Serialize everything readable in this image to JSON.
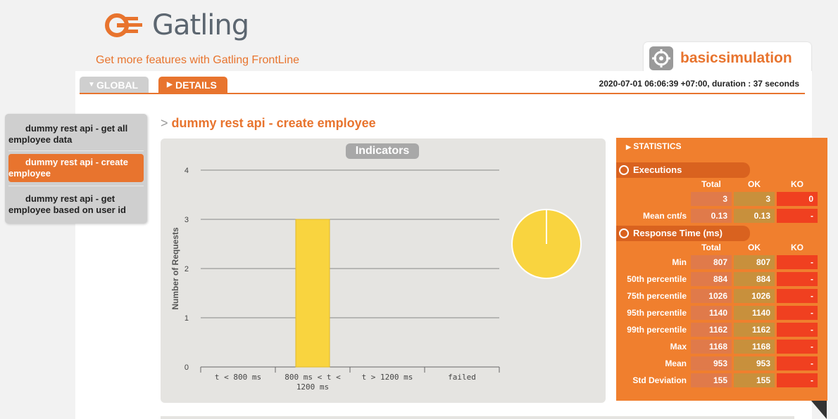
{
  "header": {
    "logo_text": "Gatling",
    "frontline_link": "Get more features with Gatling FrontLine",
    "simulation_name": "basicsimulation"
  },
  "tabs": [
    {
      "label": "GLOBAL"
    },
    {
      "label": "DETAILS"
    }
  ],
  "run_info": "2020-07-01 06:06:39 +07:00, duration : 37 seconds",
  "sidebar": {
    "items": [
      {
        "line1": "dummy rest api - get all",
        "line2": "employee data"
      },
      {
        "line1": "dummy rest api - create",
        "line2": "employee"
      },
      {
        "line1": "dummy rest api - get",
        "line2": "employee based on user id"
      }
    ]
  },
  "request_title": "dummy rest api - create employee",
  "request_arrow": ">",
  "indicators_label": "Indicators",
  "chart_data": {
    "type": "bar",
    "categories": [
      "t < 800 ms",
      "800 ms < t < 1200 ms",
      "t > 1200 ms",
      "failed"
    ],
    "category_lines": [
      [
        "t < 800 ms"
      ],
      [
        "800 ms < t <",
        "1200 ms"
      ],
      [
        "t > 1200 ms"
      ],
      [
        "failed"
      ]
    ],
    "values": [
      0,
      3,
      0,
      0
    ],
    "ylabel": "Number of Requests",
    "ylim": [
      0,
      4
    ],
    "yticks": [
      "0",
      "1",
      "2",
      "3",
      "4"
    ],
    "grid": true,
    "bar_color": "#f9d43f",
    "pie": {
      "type": "pie",
      "values": [
        0,
        3,
        0,
        0
      ],
      "color": "#f9d43f"
    }
  },
  "statistics": {
    "title": "STATISTICS",
    "executions_label": "Executions",
    "response_time_label": "Response Time (ms)",
    "columns": [
      "Total",
      "OK",
      "KO"
    ],
    "executions": [
      {
        "label": "",
        "total": "3",
        "ok": "3",
        "ko": "0"
      },
      {
        "label": "Mean cnt/s",
        "total": "0.13",
        "ok": "0.13",
        "ko": "-"
      }
    ],
    "response_time": [
      {
        "label": "Min",
        "total": "807",
        "ok": "807",
        "ko": "-"
      },
      {
        "label": "50th percentile",
        "total": "884",
        "ok": "884",
        "ko": "-"
      },
      {
        "label": "75th percentile",
        "total": "1026",
        "ok": "1026",
        "ko": "-"
      },
      {
        "label": "95th percentile",
        "total": "1140",
        "ok": "1140",
        "ko": "-"
      },
      {
        "label": "99th percentile",
        "total": "1162",
        "ok": "1162",
        "ko": "-"
      },
      {
        "label": "Max",
        "total": "1168",
        "ok": "1168",
        "ko": "-"
      },
      {
        "label": "Mean",
        "total": "953",
        "ok": "953",
        "ko": "-"
      },
      {
        "label": "Std Deviation",
        "total": "155",
        "ok": "155",
        "ko": "-"
      }
    ]
  },
  "colors": {
    "accent": "#e8742e",
    "ko": "#f04020"
  }
}
